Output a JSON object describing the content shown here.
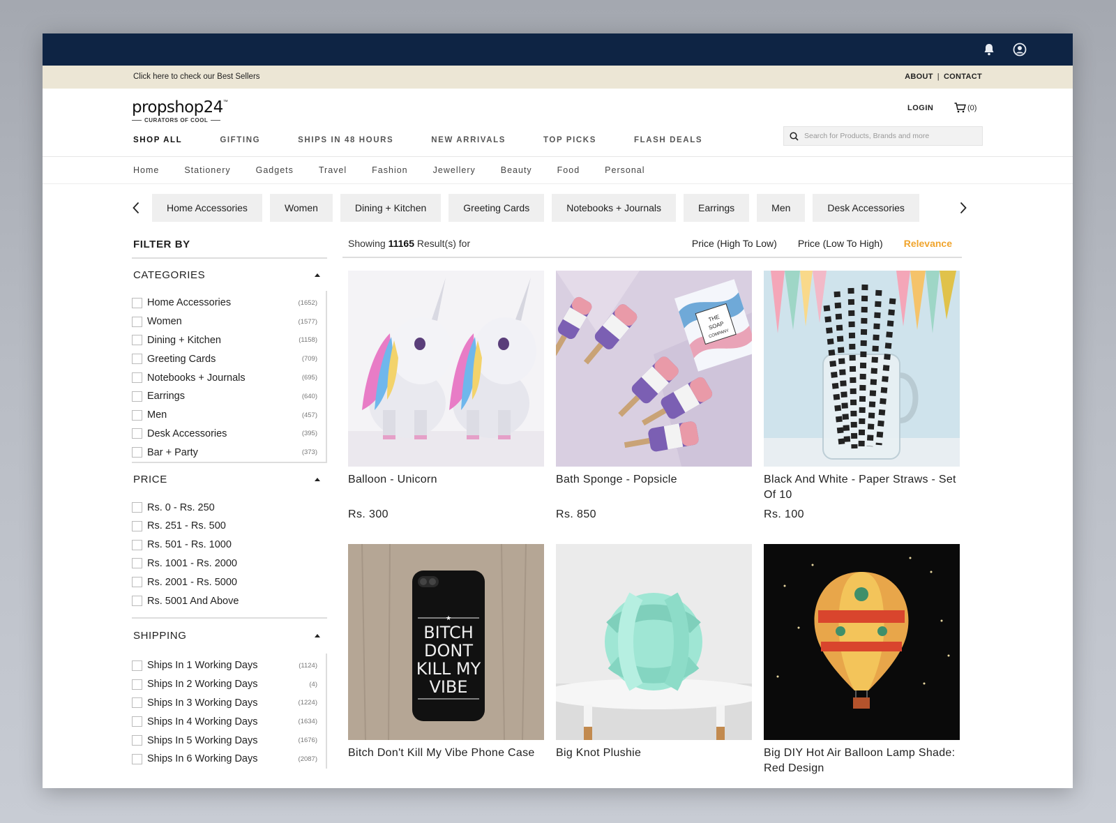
{
  "topbar": {
    "bell_icon": "bell-icon",
    "account_icon": "user-circle-icon"
  },
  "promo": {
    "text": "Click here to check our Best Sellers",
    "about": "ABOUT",
    "contact": "CONTACT"
  },
  "brand": {
    "name": "propshop24",
    "tm": "™",
    "tagline": "CURATORS OF COOL"
  },
  "header": {
    "login": "LOGIN",
    "cart_count": "(0)",
    "search_placeholder": "Search for Products, Brands and more"
  },
  "mainnav": [
    "SHOP ALL",
    "GIFTING",
    "SHIPS IN 48 HOURS",
    "NEW ARRIVALS",
    "TOP PICKS",
    "FLASH DEALS"
  ],
  "subnav": [
    "Home",
    "Stationery",
    "Gadgets",
    "Travel",
    "Fashion",
    "Jewellery",
    "Beauty",
    "Food",
    "Personal"
  ],
  "chips": [
    "Home Accessories",
    "Women",
    "Dining + Kitchen",
    "Greeting Cards",
    "Notebooks + Journals",
    "Earrings",
    "Men",
    "Desk Accessories"
  ],
  "filter": {
    "title": "FILTER BY",
    "categories": {
      "label": "CATEGORIES",
      "options": [
        {
          "name": "Home Accessories",
          "count": "(1652)"
        },
        {
          "name": "Women",
          "count": "(1577)"
        },
        {
          "name": "Dining + Kitchen",
          "count": "(1158)"
        },
        {
          "name": "Greeting Cards",
          "count": "(709)"
        },
        {
          "name": "Notebooks + Journals",
          "count": "(695)"
        },
        {
          "name": "Earrings",
          "count": "(640)"
        },
        {
          "name": "Men",
          "count": "(457)"
        },
        {
          "name": "Desk Accessories",
          "count": "(395)"
        },
        {
          "name": "Bar + Party",
          "count": "(373)"
        }
      ]
    },
    "price": {
      "label": "PRICE",
      "options": [
        "Rs. 0 - Rs. 250",
        "Rs. 251 - Rs. 500",
        "Rs. 501 - Rs. 1000",
        "Rs. 1001 - Rs. 2000",
        "Rs. 2001 - Rs. 5000",
        "Rs. 5001 And Above"
      ]
    },
    "shipping": {
      "label": "SHIPPING",
      "options": [
        {
          "name": "Ships In 1 Working Days",
          "count": "(1124)"
        },
        {
          "name": "Ships In 2 Working Days",
          "count": "(4)"
        },
        {
          "name": "Ships In 3 Working Days",
          "count": "(1224)"
        },
        {
          "name": "Ships In 4 Working Days",
          "count": "(1634)"
        },
        {
          "name": "Ships In 5 Working Days",
          "count": "(1676)"
        },
        {
          "name": "Ships In 6 Working Days",
          "count": "(2087)"
        }
      ]
    }
  },
  "results": {
    "prefix": "Showing",
    "count": "11165",
    "suffix": "Result(s) for",
    "sorts": [
      "Price (High To Low)",
      "Price (Low To High)",
      "Relevance"
    ],
    "active_sort": "Relevance",
    "accent": "#f0a42c"
  },
  "products": [
    {
      "title": "Balloon - Unicorn",
      "price": "Rs. 300"
    },
    {
      "title": "Bath Sponge - Popsicle",
      "price": "Rs. 850"
    },
    {
      "title": "Black And White - Paper Straws - Set Of 10",
      "price": "Rs. 100"
    },
    {
      "title": "Bitch Don't Kill My Vibe Phone Case",
      "price": "",
      "case_text": [
        "BITCH",
        "DONT",
        "KILL MY",
        "VIBE"
      ]
    },
    {
      "title": "Big Knot Plushie",
      "price": ""
    },
    {
      "title": "Big DIY Hot Air Balloon Lamp Shade: Red Design",
      "price": ""
    }
  ],
  "sponge_box_text": [
    "THE",
    "SOAP",
    "COMPANY"
  ],
  "colors": {
    "topbar": "#0e2444",
    "promo": "#ece6d5",
    "chip": "#efefef"
  }
}
